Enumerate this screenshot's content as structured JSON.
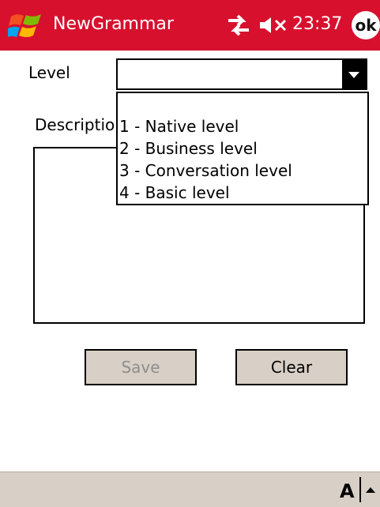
{
  "titlebar": {
    "app_title": "NewGrammar",
    "time": "23:37",
    "ok_label": "ok",
    "icons": [
      "windows-start-icon",
      "connectivity-icon",
      "volume-muted-icon",
      "ok-icon"
    ]
  },
  "form": {
    "level_label": "Level",
    "level_selected": "",
    "description_label": "Descriptio",
    "description_value": "",
    "dropdown_options": [
      "1 - Native level",
      "2 - Business level",
      "3 - Conversation level",
      "4 - Basic level"
    ],
    "save_label": "Save",
    "clear_label": "Clear"
  },
  "bottombar": {
    "input_label": "A",
    "icons": [
      "input-method-icon",
      "input-panel-arrow-icon"
    ]
  },
  "colors": {
    "titlebar": "#d7102e",
    "button_bg": "#d8cfc6",
    "disabled_text": "#8e8e8e"
  }
}
